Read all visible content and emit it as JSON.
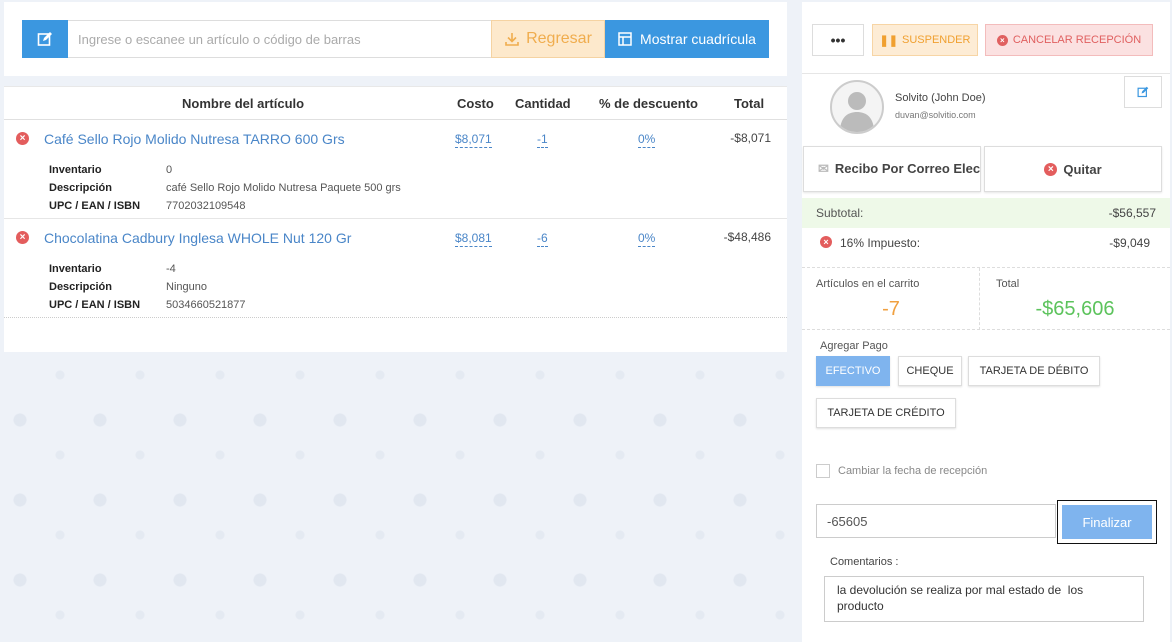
{
  "scan": {
    "placeholder": "Ingrese o escanee un artículo o código de barras",
    "return_label": "Regresar",
    "grid_label": "Mostrar cuadrícula"
  },
  "table": {
    "headers": {
      "name": "Nombre del artículo",
      "cost": "Costo",
      "qty": "Cantidad",
      "discount": "% de descuento",
      "total": "Total"
    },
    "detail_labels": {
      "inventory": "Inventario",
      "description": "Descripción",
      "upc": "UPC / EAN / ISBN"
    },
    "items": [
      {
        "name": "Café Sello Rojo Molido Nutresa TARRO 600 Grs",
        "cost": "$8,071",
        "qty": "-1",
        "discount": "0%",
        "total": "-$8,071",
        "inventory": "0",
        "description": "café Sello Rojo Molido Nutresa Paquete 500 grs",
        "upc": "7702032109548"
      },
      {
        "name": "Chocolatina Cadbury Inglesa WHOLE Nut 120 Gr",
        "cost": "$8,081",
        "qty": "-6",
        "discount": "0%",
        "total": "-$48,486",
        "inventory": "-4",
        "description": "Ninguno",
        "upc": "5034660521877"
      }
    ]
  },
  "actions": {
    "more": "•••",
    "suspend": "SUSPENDER",
    "cancel": "CANCELAR RECEPCIÓN"
  },
  "customer": {
    "name": "Solvito (John Doe)",
    "email": "duvan@solvitio.com",
    "email_receipt": "Recibo Por Correo Electrónico",
    "remove": "Quitar"
  },
  "totals": {
    "subtotal_label": "Subtotal:",
    "subtotal": "-$56,557",
    "tax_label": "16% Impuesto:",
    "tax": "-$9,049",
    "cart_items_label": "Artículos en el carrito",
    "cart_items": "-7",
    "total_label": "Total",
    "total": "-$65,606"
  },
  "payment": {
    "caption": "Agregar Pago",
    "methods": [
      "EFECTIVO",
      "CHEQUE",
      "TARJETA DE DÉBITO",
      "TARJETA DE CRÉDITO"
    ],
    "change_date_label": "Cambiar la fecha de recepción",
    "amount": "-65605",
    "finalize": "Finalizar"
  },
  "comments": {
    "label": "Comentarios :",
    "text": "la devolución se realiza por mal estado de  los producto"
  },
  "colors": {
    "primary": "#3b97e0",
    "warning": "#f0ad4e",
    "danger": "#e35d5d",
    "success": "#5cc35c"
  }
}
